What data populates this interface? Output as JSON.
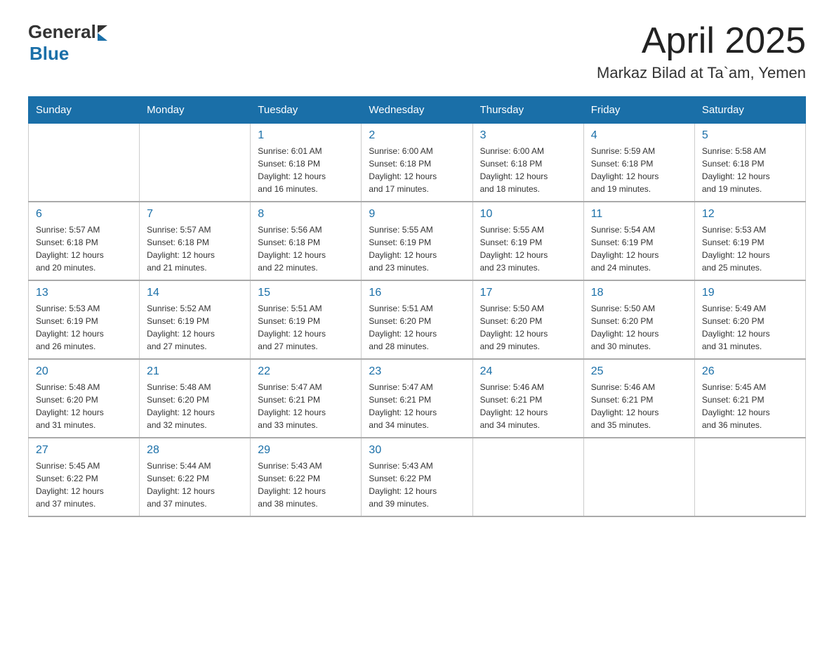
{
  "logo": {
    "general": "General",
    "blue": "Blue"
  },
  "title": "April 2025",
  "subtitle": "Markaz Bilad at Ta`am, Yemen",
  "days_of_week": [
    "Sunday",
    "Monday",
    "Tuesday",
    "Wednesday",
    "Thursday",
    "Friday",
    "Saturday"
  ],
  "weeks": [
    [
      {
        "day": "",
        "info": ""
      },
      {
        "day": "",
        "info": ""
      },
      {
        "day": "1",
        "info": "Sunrise: 6:01 AM\nSunset: 6:18 PM\nDaylight: 12 hours\nand 16 minutes."
      },
      {
        "day": "2",
        "info": "Sunrise: 6:00 AM\nSunset: 6:18 PM\nDaylight: 12 hours\nand 17 minutes."
      },
      {
        "day": "3",
        "info": "Sunrise: 6:00 AM\nSunset: 6:18 PM\nDaylight: 12 hours\nand 18 minutes."
      },
      {
        "day": "4",
        "info": "Sunrise: 5:59 AM\nSunset: 6:18 PM\nDaylight: 12 hours\nand 19 minutes."
      },
      {
        "day": "5",
        "info": "Sunrise: 5:58 AM\nSunset: 6:18 PM\nDaylight: 12 hours\nand 19 minutes."
      }
    ],
    [
      {
        "day": "6",
        "info": "Sunrise: 5:57 AM\nSunset: 6:18 PM\nDaylight: 12 hours\nand 20 minutes."
      },
      {
        "day": "7",
        "info": "Sunrise: 5:57 AM\nSunset: 6:18 PM\nDaylight: 12 hours\nand 21 minutes."
      },
      {
        "day": "8",
        "info": "Sunrise: 5:56 AM\nSunset: 6:18 PM\nDaylight: 12 hours\nand 22 minutes."
      },
      {
        "day": "9",
        "info": "Sunrise: 5:55 AM\nSunset: 6:19 PM\nDaylight: 12 hours\nand 23 minutes."
      },
      {
        "day": "10",
        "info": "Sunrise: 5:55 AM\nSunset: 6:19 PM\nDaylight: 12 hours\nand 23 minutes."
      },
      {
        "day": "11",
        "info": "Sunrise: 5:54 AM\nSunset: 6:19 PM\nDaylight: 12 hours\nand 24 minutes."
      },
      {
        "day": "12",
        "info": "Sunrise: 5:53 AM\nSunset: 6:19 PM\nDaylight: 12 hours\nand 25 minutes."
      }
    ],
    [
      {
        "day": "13",
        "info": "Sunrise: 5:53 AM\nSunset: 6:19 PM\nDaylight: 12 hours\nand 26 minutes."
      },
      {
        "day": "14",
        "info": "Sunrise: 5:52 AM\nSunset: 6:19 PM\nDaylight: 12 hours\nand 27 minutes."
      },
      {
        "day": "15",
        "info": "Sunrise: 5:51 AM\nSunset: 6:19 PM\nDaylight: 12 hours\nand 27 minutes."
      },
      {
        "day": "16",
        "info": "Sunrise: 5:51 AM\nSunset: 6:20 PM\nDaylight: 12 hours\nand 28 minutes."
      },
      {
        "day": "17",
        "info": "Sunrise: 5:50 AM\nSunset: 6:20 PM\nDaylight: 12 hours\nand 29 minutes."
      },
      {
        "day": "18",
        "info": "Sunrise: 5:50 AM\nSunset: 6:20 PM\nDaylight: 12 hours\nand 30 minutes."
      },
      {
        "day": "19",
        "info": "Sunrise: 5:49 AM\nSunset: 6:20 PM\nDaylight: 12 hours\nand 31 minutes."
      }
    ],
    [
      {
        "day": "20",
        "info": "Sunrise: 5:48 AM\nSunset: 6:20 PM\nDaylight: 12 hours\nand 31 minutes."
      },
      {
        "day": "21",
        "info": "Sunrise: 5:48 AM\nSunset: 6:20 PM\nDaylight: 12 hours\nand 32 minutes."
      },
      {
        "day": "22",
        "info": "Sunrise: 5:47 AM\nSunset: 6:21 PM\nDaylight: 12 hours\nand 33 minutes."
      },
      {
        "day": "23",
        "info": "Sunrise: 5:47 AM\nSunset: 6:21 PM\nDaylight: 12 hours\nand 34 minutes."
      },
      {
        "day": "24",
        "info": "Sunrise: 5:46 AM\nSunset: 6:21 PM\nDaylight: 12 hours\nand 34 minutes."
      },
      {
        "day": "25",
        "info": "Sunrise: 5:46 AM\nSunset: 6:21 PM\nDaylight: 12 hours\nand 35 minutes."
      },
      {
        "day": "26",
        "info": "Sunrise: 5:45 AM\nSunset: 6:21 PM\nDaylight: 12 hours\nand 36 minutes."
      }
    ],
    [
      {
        "day": "27",
        "info": "Sunrise: 5:45 AM\nSunset: 6:22 PM\nDaylight: 12 hours\nand 37 minutes."
      },
      {
        "day": "28",
        "info": "Sunrise: 5:44 AM\nSunset: 6:22 PM\nDaylight: 12 hours\nand 37 minutes."
      },
      {
        "day": "29",
        "info": "Sunrise: 5:43 AM\nSunset: 6:22 PM\nDaylight: 12 hours\nand 38 minutes."
      },
      {
        "day": "30",
        "info": "Sunrise: 5:43 AM\nSunset: 6:22 PM\nDaylight: 12 hours\nand 39 minutes."
      },
      {
        "day": "",
        "info": ""
      },
      {
        "day": "",
        "info": ""
      },
      {
        "day": "",
        "info": ""
      }
    ]
  ]
}
